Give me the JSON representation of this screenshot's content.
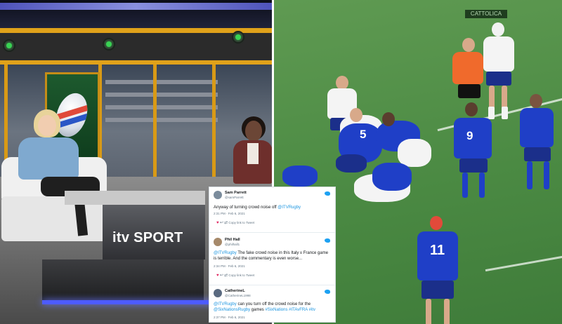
{
  "studio": {
    "logo_text": "itv SPORT"
  },
  "match": {
    "numbers": {
      "nine": "9",
      "five": "5",
      "eleven": "11"
    },
    "adboard_text": "CATTOLICA"
  },
  "tweets": [
    {
      "name": "Sam Parrett",
      "handle": "@samParrett",
      "text_before": "Anyway of turning crowd noise off ",
      "mention": "@ITVRugby",
      "text_after": "",
      "time": "2:31 PM · Feb 6, 2021",
      "actions": "Copy link to Tweet"
    },
    {
      "name": "Phil Hall",
      "handle": "@philhall1",
      "text_before": "",
      "mention": "@ITVRugby",
      "text_after": " The fake crowd noise in this Italy v France game is terrible. And the commentary is even worse...",
      "time": "2:34 PM · Feb 6, 2021",
      "actions": "Copy link to Tweet"
    },
    {
      "name": "CatherineL",
      "handle": "@CatherineL1998",
      "text_before": "",
      "mention": "@ITVRugby",
      "text_after": " can you turn off the crowd noise for the ",
      "mention2": "@SixNationsRugby",
      "text_after2": " games ",
      "hashtags": "#SixNations #ITAvFRA #itv",
      "time": "2:37 PM · Feb 6, 2021"
    }
  ],
  "colors": {
    "france_blue": "#1f3fc7",
    "italy_white": "#f4f4f4",
    "referee_orange": "#f06a2c",
    "twitter_blue": "#1da1f2",
    "studio_gold": "#e0a21a"
  }
}
